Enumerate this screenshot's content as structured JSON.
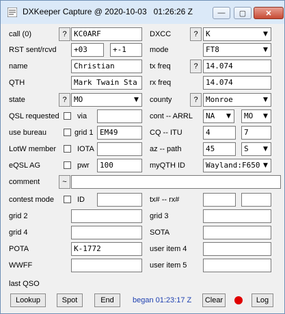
{
  "window": {
    "title": "DXKeeper Capture @ 2020-10-03   01:26:26 Z",
    "minimize_glyph": "—",
    "maximize_glyph": "▢",
    "close_glyph": "✕"
  },
  "help_glyph": "?",
  "combo_arrow": "▼",
  "fields": {
    "call_label": "call (0)",
    "call": "KC0ARF",
    "dxcc_label": "DXCC",
    "dxcc": "K",
    "rst_label": "RST sent/rcvd",
    "rst_sent": "+03",
    "rst_rcvd": "+-1",
    "mode_label": "mode",
    "mode": "FT8",
    "name_label": "name",
    "name": "Christian",
    "txfreq_label": "tx freq",
    "txfreq": "14.074",
    "qth_label": "QTH",
    "qth": "Mark Twain Sta",
    "rxfreq_label": "rx freq",
    "rxfreq": "14.074",
    "state_label": "state",
    "state": "MO",
    "county_label": "county",
    "county": "Monroe",
    "qslreq_label": "QSL requested",
    "via_label": "via",
    "via": "",
    "cont_label": "cont -- ARRL",
    "cont": "NA",
    "arrl": "MO",
    "bureau_label": "use bureau",
    "grid1_label": "grid 1",
    "grid1": "EM49",
    "cq_label": "CQ  -- ITU",
    "cq": "4",
    "itu": "7",
    "lotw_label": "LotW member",
    "iota_label": "IOTA",
    "iota": "",
    "az_label": "az  -- path",
    "az": "45",
    "path": "S",
    "eqsl_label": "eQSL AG",
    "pwr_label": "pwr",
    "pwr": "100",
    "myqth_label": "myQTH ID",
    "myqth": "Wayland:F650",
    "comment_label": "comment",
    "comment_btn": "~",
    "comment": "",
    "contest_label": "contest mode",
    "id_label": "ID",
    "id": "",
    "txrx_label": "tx#  -- rx#",
    "txnum": "",
    "rxnum": "",
    "grid2_label": "grid 2",
    "grid2": "",
    "grid3_label": "grid 3",
    "grid3": "",
    "grid4_label": "grid 4",
    "grid4": "",
    "sota_label": "SOTA",
    "sota": "",
    "pota_label": "POTA",
    "pota": "K-1772",
    "user4_label": "user item 4",
    "user4": "",
    "wwff_label": "WWFF",
    "wwff": "",
    "user5_label": "user item 5",
    "user5": ""
  },
  "last_qso_label": "last QSO",
  "buttons": {
    "lookup": "Lookup",
    "spot": "Spot",
    "end": "End",
    "clear": "Clear",
    "log": "Log"
  },
  "began": "began 01:23:17 Z",
  "colors": {
    "began_text": "#1d3fb0",
    "record_led": "#e00000",
    "titlebar": "#dbe9f8"
  }
}
